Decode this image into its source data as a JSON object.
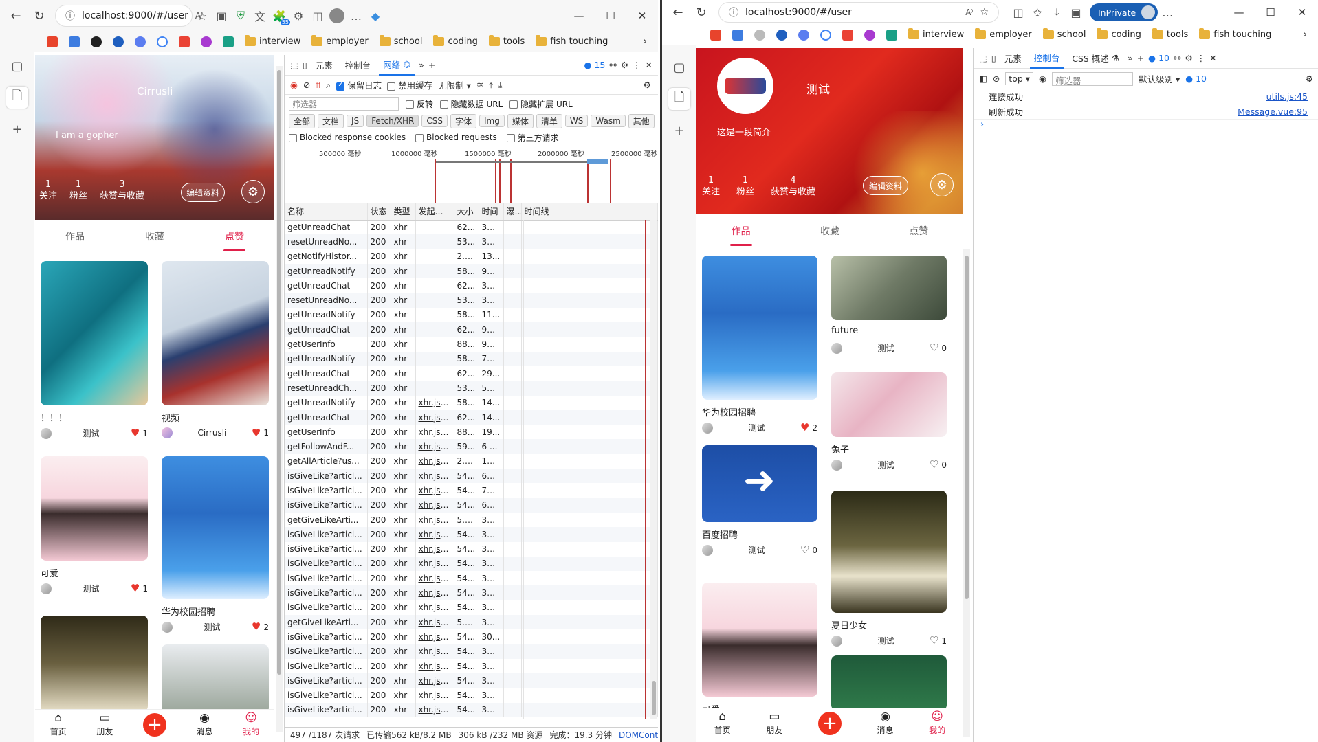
{
  "browser": {
    "url": "localhost:9000/#/user",
    "inprivate_label": "InPrivate",
    "favorites": [
      {
        "label": "interview"
      },
      {
        "label": "employer"
      },
      {
        "label": "school"
      },
      {
        "label": "coding"
      },
      {
        "label": "tools"
      },
      {
        "label": "fish touching"
      }
    ],
    "ext_badge": "55"
  },
  "left_app": {
    "username": "Cirrusli",
    "bio": "I am a gopher",
    "stats": [
      {
        "value": "1",
        "label": "关注"
      },
      {
        "value": "1",
        "label": "粉丝"
      },
      {
        "value": "3",
        "label": "获赞与收藏"
      }
    ],
    "edit_label": "编辑资料",
    "tabs": [
      "作品",
      "收藏",
      "点赞"
    ],
    "active_tab": "点赞",
    "cards": [
      {
        "title": "！！！",
        "author": "测试",
        "likes": "1",
        "liked": true
      },
      {
        "title": "视频",
        "author": "Cirrusli",
        "likes": "1",
        "liked": true
      },
      {
        "title": "可爱",
        "author": "测试",
        "likes": "1",
        "liked": true
      },
      {
        "title": "华为校园招聘",
        "author": "测试",
        "likes": "2",
        "liked": true
      }
    ]
  },
  "right_app": {
    "username": "测试",
    "bio": "这是一段简介",
    "stats": [
      {
        "value": "1",
        "label": "关注"
      },
      {
        "value": "1",
        "label": "粉丝"
      },
      {
        "value": "4",
        "label": "获赞与收藏"
      }
    ],
    "edit_label": "编辑资料",
    "tabs": [
      "作品",
      "收藏",
      "点赞"
    ],
    "active_tab": "作品",
    "cards": [
      {
        "title": "华为校园招聘",
        "author": "测试",
        "likes": "2",
        "liked": true
      },
      {
        "title": "future",
        "author": "测试",
        "likes": "0",
        "liked": false
      },
      {
        "title": "百度招聘",
        "author": "测试",
        "likes": "0",
        "liked": false
      },
      {
        "title": "兔子",
        "author": "测试",
        "likes": "0",
        "liked": false
      },
      {
        "title": "夏日少女",
        "author": "测试",
        "likes": "1",
        "liked": false
      },
      {
        "title": "可爱",
        "author": "",
        "likes": "",
        "liked": false
      }
    ]
  },
  "bottom_nav": [
    {
      "label": "首页",
      "icon": "home-icon"
    },
    {
      "label": "朋友",
      "icon": "bag-icon"
    },
    {
      "label": "",
      "icon": "plus-icon"
    },
    {
      "label": "消息",
      "icon": "message-icon"
    },
    {
      "label": "我的",
      "icon": "user-icon"
    }
  ],
  "devtools_left": {
    "tabs": [
      "元素",
      "控制台",
      "网络"
    ],
    "active_tab": "网络",
    "issues_count": "15",
    "preserve_log": "保留日志",
    "disable_cache": "禁用缓存",
    "throttle": "无限制",
    "filter_placeholder": "筛选器",
    "invert": "反转",
    "hide_data_url": "隐藏数据 URL",
    "hide_ext_url": "隐藏扩展 URL",
    "type_filters": [
      "全部",
      "文档",
      "JS",
      "Fetch/XHR",
      "CSS",
      "字体",
      "Img",
      "媒体",
      "清单",
      "WS",
      "Wasm",
      "其他"
    ],
    "active_type": "Fetch/XHR",
    "blocked_cookies": "Blocked response cookies",
    "blocked_requests": "Blocked requests",
    "third_party": "第三方请求",
    "timeline_ticks": [
      "500000 毫秒",
      "1000000 毫秒",
      "1500000 毫秒",
      "2000000 毫秒",
      "2500000 毫秒"
    ],
    "columns": [
      "名称",
      "状态",
      "类型",
      "发起程...",
      "大小",
      "时间",
      "瀑...",
      "时间线"
    ],
    "rows": [
      {
        "name": "getUnreadChat",
        "status": "200",
        "type": "xhr",
        "init": "",
        "size": "62...",
        "time": "32 ..."
      },
      {
        "name": "resetUnreadNo...",
        "status": "200",
        "type": "xhr",
        "init": "",
        "size": "53...",
        "time": "32 ..."
      },
      {
        "name": "getNotifyHistor...",
        "status": "200",
        "type": "xhr",
        "init": "",
        "size": "2.8...",
        "time": "13..."
      },
      {
        "name": "getUnreadNotify",
        "status": "200",
        "type": "xhr",
        "init": "",
        "size": "58...",
        "time": "97 ..."
      },
      {
        "name": "getUnreadChat",
        "status": "200",
        "type": "xhr",
        "init": "",
        "size": "62...",
        "time": "31 ..."
      },
      {
        "name": "resetUnreadNo...",
        "status": "200",
        "type": "xhr",
        "init": "",
        "size": "53...",
        "time": "32 ..."
      },
      {
        "name": "getUnreadNotify",
        "status": "200",
        "type": "xhr",
        "init": "",
        "size": "58...",
        "time": "11..."
      },
      {
        "name": "getUnreadChat",
        "status": "200",
        "type": "xhr",
        "init": "",
        "size": "62...",
        "time": "99 ..."
      },
      {
        "name": "getUserInfo",
        "status": "200",
        "type": "xhr",
        "init": "",
        "size": "88...",
        "time": "99 ..."
      },
      {
        "name": "getUnreadNotify",
        "status": "200",
        "type": "xhr",
        "init": "",
        "size": "58...",
        "time": "78 ..."
      },
      {
        "name": "getUnreadChat",
        "status": "200",
        "type": "xhr",
        "init": "",
        "size": "62...",
        "time": "29..."
      },
      {
        "name": "resetUnreadCh...",
        "status": "200",
        "type": "xhr",
        "init": "",
        "size": "53...",
        "time": "58 ..."
      },
      {
        "name": "getUnreadNotify",
        "status": "200",
        "type": "xhr",
        "init": "xhr.js:2...",
        "size": "58...",
        "time": "14..."
      },
      {
        "name": "getUnreadChat",
        "status": "200",
        "type": "xhr",
        "init": "xhr.js:2...",
        "size": "62...",
        "time": "14..."
      },
      {
        "name": "getUserInfo",
        "status": "200",
        "type": "xhr",
        "init": "xhr.js:2...",
        "size": "88...",
        "time": "19..."
      },
      {
        "name": "getFollowAndF...",
        "status": "200",
        "type": "xhr",
        "init": "xhr.js:2...",
        "size": "59...",
        "time": "6 ..."
      },
      {
        "name": "getAllArticle?us...",
        "status": "200",
        "type": "xhr",
        "init": "xhr.js:2...",
        "size": "2.9...",
        "time": "10 ..."
      },
      {
        "name": "isGiveLike?articl...",
        "status": "200",
        "type": "xhr",
        "init": "xhr.js:2...",
        "size": "54...",
        "time": "68 ..."
      },
      {
        "name": "isGiveLike?articl...",
        "status": "200",
        "type": "xhr",
        "init": "xhr.js:2...",
        "size": "54...",
        "time": "70 ..."
      },
      {
        "name": "isGiveLike?articl...",
        "status": "200",
        "type": "xhr",
        "init": "xhr.js:2...",
        "size": "54...",
        "time": "67 ..."
      },
      {
        "name": "getGiveLikeArti...",
        "status": "200",
        "type": "xhr",
        "init": "xhr.js:2...",
        "size": "5.3...",
        "time": "34 ..."
      },
      {
        "name": "isGiveLike?articl...",
        "status": "200",
        "type": "xhr",
        "init": "xhr.js:2...",
        "size": "54...",
        "time": "32 ..."
      },
      {
        "name": "isGiveLike?articl...",
        "status": "200",
        "type": "xhr",
        "init": "xhr.js:2...",
        "size": "54...",
        "time": "33 ..."
      },
      {
        "name": "isGiveLike?articl...",
        "status": "200",
        "type": "xhr",
        "init": "xhr.js:2...",
        "size": "54...",
        "time": "38 ..."
      },
      {
        "name": "isGiveLike?articl...",
        "status": "200",
        "type": "xhr",
        "init": "xhr.js:2...",
        "size": "54...",
        "time": "38 ..."
      },
      {
        "name": "isGiveLike?articl...",
        "status": "200",
        "type": "xhr",
        "init": "xhr.js:2...",
        "size": "54...",
        "time": "34 ..."
      },
      {
        "name": "isGiveLike?articl...",
        "status": "200",
        "type": "xhr",
        "init": "xhr.js:2...",
        "size": "54...",
        "time": "37 ..."
      },
      {
        "name": "getGiveLikeArti...",
        "status": "200",
        "type": "xhr",
        "init": "xhr.js:2...",
        "size": "5.3...",
        "time": "38 ..."
      },
      {
        "name": "isGiveLike?articl...",
        "status": "200",
        "type": "xhr",
        "init": "xhr.js:2...",
        "size": "54...",
        "time": "30..."
      },
      {
        "name": "isGiveLike?articl...",
        "status": "200",
        "type": "xhr",
        "init": "xhr.js:2...",
        "size": "54...",
        "time": "39 ..."
      },
      {
        "name": "isGiveLike?articl...",
        "status": "200",
        "type": "xhr",
        "init": "xhr.js:2...",
        "size": "54...",
        "time": "36 ..."
      },
      {
        "name": "isGiveLike?articl...",
        "status": "200",
        "type": "xhr",
        "init": "xhr.js:2...",
        "size": "54...",
        "time": "36 ..."
      },
      {
        "name": "isGiveLike?articl...",
        "status": "200",
        "type": "xhr",
        "init": "xhr.js:2...",
        "size": "54...",
        "time": "30 ..."
      },
      {
        "name": "isGiveLike?articl...",
        "status": "200",
        "type": "xhr",
        "init": "xhr.js:2...",
        "size": "54...",
        "time": "30 ..."
      }
    ],
    "status_bar": {
      "requests": "497 /1187 次请求",
      "transferred": "已传输562 kB/8.2 MB",
      "resources": "306 kB /232 MB 资源",
      "finish": "完成：19.3 分钟",
      "dcl": "DOMContentLoade"
    }
  },
  "devtools_right": {
    "tabs": [
      "元素",
      "控制台",
      "CSS 概述"
    ],
    "active_tab": "控制台",
    "issues_count": "10",
    "context": "top",
    "filter_placeholder": "筛选器",
    "level": "默认级别",
    "level_count": "10",
    "logs": [
      {
        "message": "连接成功",
        "source": "utils.js:45"
      },
      {
        "message": "刷新成功",
        "source": "Message.vue:95"
      }
    ]
  },
  "colors": {
    "accent": "#e0204a",
    "plus_button": "#f0321e",
    "link": "#1a55c8",
    "devtools_active": "#1a73e8"
  }
}
